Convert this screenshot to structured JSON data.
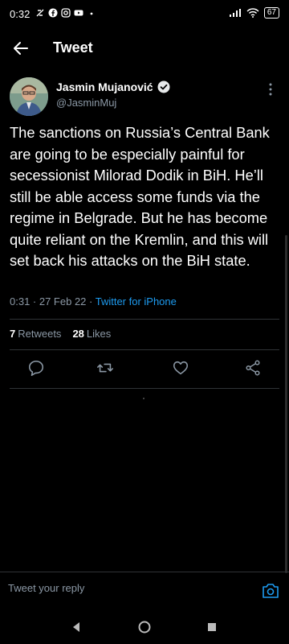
{
  "status_bar": {
    "time": "0:32",
    "battery": "67",
    "icons": [
      "notification-icon",
      "facebook-icon",
      "instagram-icon",
      "youtube-icon",
      "dot-icon",
      "signal-icon",
      "wifi-icon",
      "battery-icon"
    ]
  },
  "header": {
    "title": "Tweet"
  },
  "tweet": {
    "author_name": "Jasmin Mujanović",
    "handle": "@JasminMuj",
    "text": "The sanctions on Russia’s Central Bank are going to be especially painful for secessionist Milorad Dodik in BiH. He’ll still be able access some funds via the regime in Belgrade. But he has become quite reliant on the Kremlin, and this will set back his attacks on the BiH state.",
    "time": "0:31 · 27 Feb 22 · ",
    "source": "Twitter for iPhone"
  },
  "stats": {
    "retweets_count": "7",
    "retweets_label": "Retweets",
    "likes_count": "28",
    "likes_label": "Likes"
  },
  "actions": [
    "reply-icon",
    "retweet-icon",
    "like-icon",
    "share-icon"
  ],
  "reply": {
    "placeholder": "Tweet your reply"
  },
  "colors": {
    "background": "#000000",
    "accent": "#1d9bf0",
    "muted": "#8b98a5"
  }
}
